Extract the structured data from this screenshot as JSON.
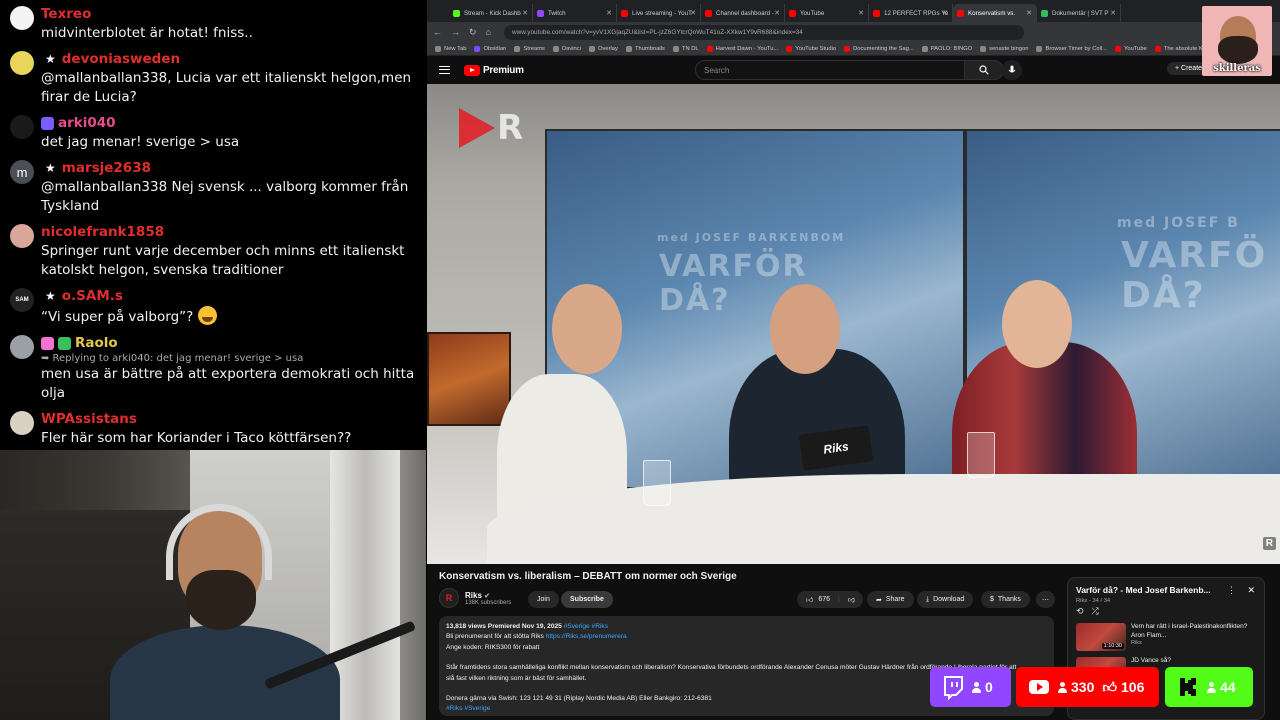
{
  "chat": {
    "messages": [
      {
        "user": "Texreo",
        "color": "#e02e2e",
        "avatar_color": "#f4f4f4",
        "avatar_text": "",
        "star": false,
        "badges": [],
        "reply": "",
        "text": "midvinterblotet är hotat! fniss.."
      },
      {
        "user": "devoniasweden",
        "color": "#e02e2e",
        "avatar_color": "#e9d65a",
        "avatar_text": "",
        "star": true,
        "badges": [],
        "reply": "",
        "text": "@mallanballan338, Lucia var ett italienskt helgon,men firar de Lucia?"
      },
      {
        "user": "arki040",
        "color": "#e74c8b",
        "avatar_color": "#1a1a1a",
        "avatar_text": "",
        "star": false,
        "badges": [
          "#7b5cff"
        ],
        "reply": "",
        "text": "det jag menar! sverige > usa"
      },
      {
        "user": "marsje2638",
        "color": "#e02e2e",
        "avatar_color": "#4a4f57",
        "avatar_text": "m",
        "star": true,
        "badges": [],
        "reply": "",
        "text": "@mallanballan338 Nej svensk ... valborg kommer från Tyskland"
      },
      {
        "user": "nicolefrank1858",
        "color": "#e02e2e",
        "avatar_color": "#d8a79a",
        "avatar_text": "",
        "star": false,
        "badges": [],
        "reply": "",
        "text": "Springer runt varje december och minns ett italienskt katolskt helgon, svenska traditioner"
      },
      {
        "user": "o.SAM.s",
        "color": "#e02e2e",
        "avatar_color": "#222222",
        "avatar_text": "SAM",
        "star": true,
        "badges": [],
        "reply": "",
        "text": "“Vi super på valborg”? "
      },
      {
        "user": "Raolo",
        "color": "#e3c84a",
        "avatar_color": "#9aa0a6",
        "avatar_text": "",
        "star": false,
        "badges": [
          "#f472d0",
          "#36c15a"
        ],
        "reply": "➥ Replying to arki040: det jag menar! sverige > usa",
        "text": "men usa är bättre på att exportera demokrati och hitta olja"
      },
      {
        "user": "WPAssistans",
        "color": "#e02e2e",
        "avatar_color": "#d9d2c4",
        "avatar_text": "",
        "star": false,
        "badges": [],
        "reply": "",
        "text": "Fler här som har Koriander i Taco köttfärsen??"
      }
    ]
  },
  "browser": {
    "tabs": [
      {
        "label": "Stream - Kick Dashb",
        "fav": "#53fc18"
      },
      {
        "label": "Twitch",
        "fav": "#9146ff"
      },
      {
        "label": "Live streaming - YouT",
        "fav": "#ff0000"
      },
      {
        "label": "Channel dashboard -",
        "fav": "#ff0000"
      },
      {
        "label": "YouTube",
        "fav": "#ff0000"
      },
      {
        "label": "12 PERFECT RPGs Yo",
        "fav": "#ff0000"
      },
      {
        "label": "Konservatism vs.",
        "fav": "#ff0000",
        "active": true
      },
      {
        "label": "Dokumentär | SVT P",
        "fav": "#2dbf5a"
      }
    ],
    "url": "www.youtube.com/watch?v=yvV1XG|aqZU&list=PL-jzZ6GYtcrQoWuT41oZ-XXkw1Y9vR688&index=34",
    "bookmarks": [
      {
        "label": "New Tab",
        "c": "#888"
      },
      {
        "label": "Obsidian",
        "c": "#7c4dff"
      },
      {
        "label": "Streams",
        "c": "#888"
      },
      {
        "label": "Davinci",
        "c": "#888"
      },
      {
        "label": "Overlay",
        "c": "#888"
      },
      {
        "label": "Thumbnails",
        "c": "#888"
      },
      {
        "label": "TN DL",
        "c": "#888"
      },
      {
        "label": "Harvest Dawn - YouTu...",
        "c": "#ff0000"
      },
      {
        "label": "YouTube Studio",
        "c": "#ff0000"
      },
      {
        "label": "Documenting the Sag...",
        "c": "#ff0000"
      },
      {
        "label": "PAOLO: BINGO",
        "c": "#888"
      },
      {
        "label": "senaste bingon",
        "c": "#888"
      },
      {
        "label": "Browser Timer by Coll...",
        "c": "#888"
      },
      {
        "label": "YouTube",
        "c": "#ff0000"
      },
      {
        "label": "The absolute KING",
        "c": "#ff0000"
      }
    ]
  },
  "youtube": {
    "logo_text": "Premium",
    "search_placeholder": "Search",
    "create_label": "+ Create",
    "video": {
      "screen_line1": "med JOSEF BARKENBOM",
      "screen_line2": "VARFÖR",
      "screen_line3": "DÅ?",
      "screen_r_line1": "med JOSEF B",
      "screen_r_line2": "VARFÖ",
      "screen_r_line3": "DÅ?",
      "ipad_text": "Riks",
      "logo_letter": "R",
      "corner_mark": "R"
    },
    "title": "Konservatism vs. liberalism – DEBATT om normer och Sverige",
    "channel": {
      "name": "Riks",
      "subs": "138K subscribers",
      "avatar": "R"
    },
    "join_label": "Join",
    "subscribe_label": "Subscribe",
    "likes": "676",
    "share_label": "Share",
    "download_label": "Download",
    "thanks_label": "Thanks",
    "description": {
      "meta": "13,818 views  Premiered Nov 19, 2025",
      "tags_inline": "#Sverige #Riks",
      "line1_pre": "Bli prenumerant för att stötta Riks ",
      "line1_link": "https://Riks.se/prenumerera",
      "line2": "Ange koden: RIKS300 för rabatt",
      "line3": "Står framtidens stora samhälleliga konflikt mellan konservatism och liberalism? Konservativa förbundets ordförande Alexander Cenusa möter Gustav Härdner från ordförande Liberala partiet för att",
      "line4": "slå fast vilken riktning som är bäst för samhället.",
      "line5": "Donera gärna via Swish: 123 121 49 31 (Riplay Nordic Media AB) Eller Bankgiro: 212-6381",
      "tags_bottom": "#Riks #Sverige"
    },
    "playlist": {
      "title": "Varför då? - Med Josef Barkenb...",
      "sub": "Riks - 34 / 34",
      "items": [
        {
          "title": "Vem har rätt i Israel-Palestinakonflikten? Aron Flam...",
          "channel": "Riks",
          "duration": "1:10:30"
        },
        {
          "title": "JD Vance så?",
          "channel": "",
          "duration": ""
        }
      ]
    }
  },
  "stats": {
    "twitch": {
      "count": "0",
      "color": "#9146ff"
    },
    "youtube": {
      "count": "330",
      "likes": "106",
      "color": "#ff0000"
    },
    "kick": {
      "count": "44",
      "color": "#53fc18"
    }
  },
  "profile": {
    "name": "skilleras"
  }
}
